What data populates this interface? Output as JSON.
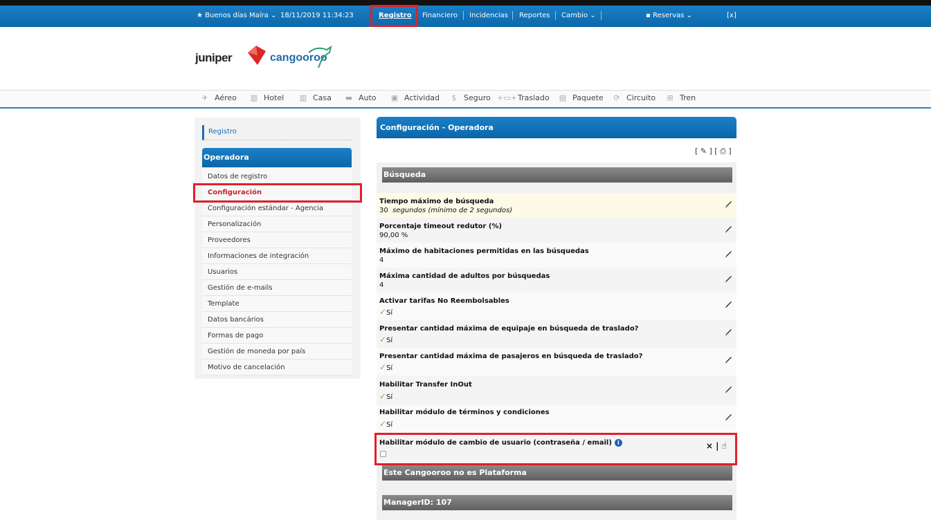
{
  "topbar": {
    "greeting": "Buenos días Maíra",
    "datetime": "18/11/2019 11:34:23",
    "menu": [
      "Registro",
      "Financiero",
      "Incidencias",
      "Reportes",
      "Cambio"
    ],
    "reservas": "Reservas",
    "close": "[x]"
  },
  "logo": {
    "left": "juniper",
    "right": "cangooroo"
  },
  "products": [
    "Aéreo",
    "Hotel",
    "Casa",
    "Auto",
    "Actividad",
    "Seguro",
    "Traslado",
    "Paquete",
    "Circuito",
    "Tren"
  ],
  "sidebar": {
    "title": "Registro",
    "section": "Operadora",
    "items": [
      "Datos de registro",
      "Configuración",
      "Configuración estándar - Agencia",
      "Personalización",
      "Proveedores",
      "Informaciones de integración",
      "Usuarios",
      "Gestión de e-mails",
      "Template",
      "Datos bancários",
      "Formas de pago",
      "Gestión de moneda por país",
      "Motivo de cancelación"
    ]
  },
  "main": {
    "title": "Configuración - Operadora",
    "tools": "[ ✎ ] [ ⎙ ]",
    "section_search": "Búsqueda",
    "rows": [
      {
        "label": "Tiempo máximo de búsqueda",
        "value": "30",
        "note": "segundos (mínimo de 2 segundos)"
      },
      {
        "label": "Porcentaje timeout redutor (%)",
        "value": "90,00  %"
      },
      {
        "label": "Máximo de habitaciones permitidas en las búsquedas",
        "value": "4"
      },
      {
        "label": "Máxima cantidad de adultos por búsquedas",
        "value": "4"
      },
      {
        "label": "Activar tarifas No Reembolsables",
        "value": "Sí"
      },
      {
        "label": "Presentar cantidad máxima de equipaje en búsqueda de traslado?",
        "value": "Sí"
      },
      {
        "label": "Presentar cantidad máxima de pasajeros en búsqueda de traslado?",
        "value": "Sí"
      },
      {
        "label": "Habilitar Transfer InOut",
        "value": "Sí"
      },
      {
        "label": "Habilitar módulo de términos y condiciones",
        "value": "Sí"
      },
      {
        "label": "Habilitar módulo de cambio de usuario (contraseña / email)"
      }
    ],
    "section_platform": "Este Cangooroo no es Plataforma",
    "section_manager": "ManagerID: 107",
    "row_actions": "×  |  ☝"
  }
}
